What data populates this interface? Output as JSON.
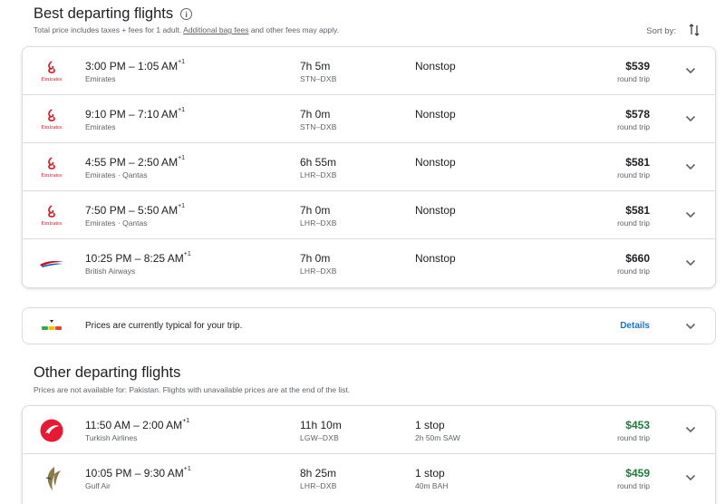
{
  "best": {
    "title": "Best departing flights",
    "subtitle_pre": "Total price includes taxes + fees for 1 adult.",
    "subtitle_link": "Additional bag fees",
    "subtitle_post": "and other fees may apply.",
    "flights": [
      {
        "times": "3:00 PM – 1:05 AM",
        "plus": "+1",
        "airline": "Emirates",
        "duration": "7h 5m",
        "route": "STN–DXB",
        "stops": "Nonstop",
        "stop_detail": "",
        "price": "$539",
        "trip": "round trip",
        "logo": "emirates-logo"
      },
      {
        "times": "9:10 PM – 7:10 AM",
        "plus": "+1",
        "airline": "Emirates",
        "duration": "7h 0m",
        "route": "STN–DXB",
        "stops": "Nonstop",
        "stop_detail": "",
        "price": "$578",
        "trip": "round trip",
        "logo": "emirates-logo"
      },
      {
        "times": "4:55 PM – 2:50 AM",
        "plus": "+1",
        "airline": "Emirates · Qantas",
        "duration": "6h 55m",
        "route": "LHR–DXB",
        "stops": "Nonstop",
        "stop_detail": "",
        "price": "$581",
        "trip": "round trip",
        "logo": "emirates-logo"
      },
      {
        "times": "7:50 PM – 5:50 AM",
        "plus": "+1",
        "airline": "Emirates · Qantas",
        "duration": "7h 0m",
        "route": "LHR–DXB",
        "stops": "Nonstop",
        "stop_detail": "",
        "price": "$581",
        "trip": "round trip",
        "logo": "emirates-logo"
      },
      {
        "times": "10:25 PM – 8:25 AM",
        "plus": "+1",
        "airline": "British Airways",
        "duration": "7h 0m",
        "route": "LHR–DXB",
        "stops": "Nonstop",
        "stop_detail": "",
        "price": "$660",
        "trip": "round trip",
        "logo": "british-airways-logo"
      }
    ]
  },
  "sort": {
    "label": "Sort by:",
    "icon": "sort-icon"
  },
  "insight": {
    "text": "Prices are currently typical for your trip.",
    "details": "Details"
  },
  "other": {
    "title": "Other departing flights",
    "subtitle": "Prices are not available for: Pakistan. Flights with unavailable prices are at the end of the list.",
    "flights": [
      {
        "times": "11:50 AM – 2:00 AM",
        "plus": "+1",
        "airline": "Turkish Airlines",
        "duration": "11h 10m",
        "route": "LGW–DXB",
        "stops": "1 stop",
        "stop_detail": "2h 50m SAW",
        "price": "$453",
        "trip": "round trip",
        "logo": "turkish-airlines-logo"
      },
      {
        "times": "10:05 PM – 9:30 AM",
        "plus": "+1",
        "airline": "Gulf Air",
        "duration": "8h 25m",
        "route": "LHR–DXB",
        "stops": "1 stop",
        "stop_detail": "40m BAH",
        "price": "$459",
        "trip": "round trip",
        "logo": "gulf-air-logo"
      }
    ]
  },
  "colors": {
    "emirates": "#d71921",
    "price_green": "#188038",
    "link_blue": "#1a73e8"
  }
}
